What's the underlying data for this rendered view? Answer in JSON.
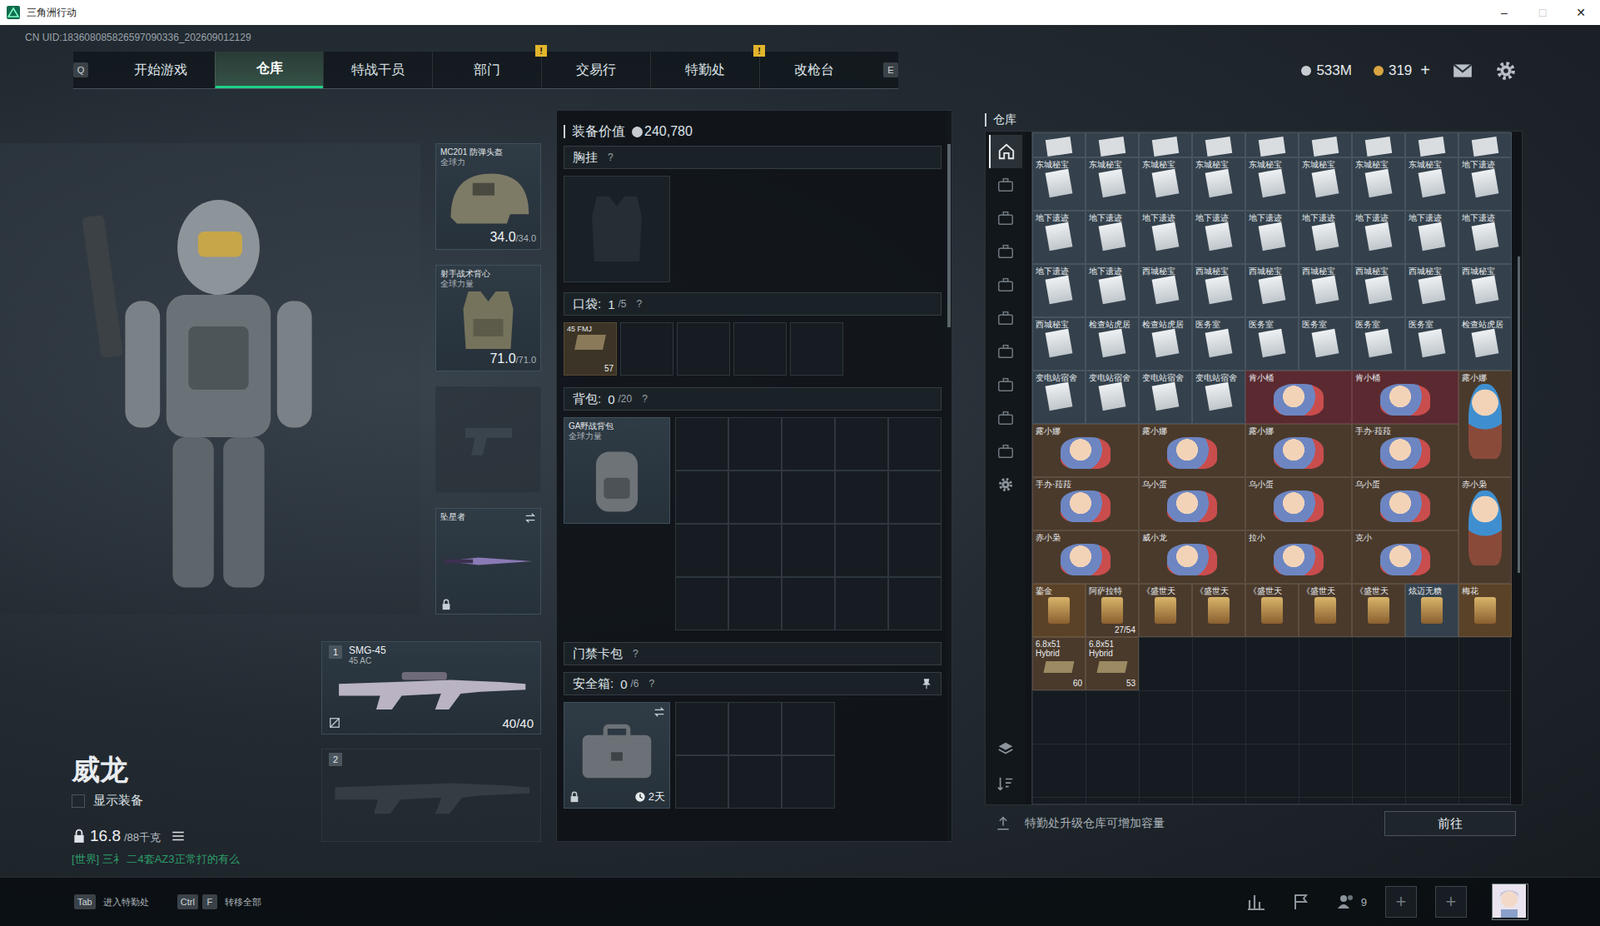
{
  "window": {
    "title": "三角洲行动",
    "controls": [
      {
        "glyph": "–",
        "disabled": false
      },
      {
        "glyph": "□",
        "disabled": true
      },
      {
        "glyph": "✕",
        "disabled": false
      }
    ]
  },
  "uid": "CN UID:183608085826597090336_202609012129",
  "nav": {
    "prev_key": "Q",
    "next_key": "E",
    "tabs": [
      {
        "label": "开始游戏",
        "selected": false,
        "badge": ""
      },
      {
        "label": "仓库",
        "selected": true,
        "badge": ""
      },
      {
        "label": "特战干员",
        "selected": false,
        "badge": ""
      },
      {
        "label": "部门",
        "selected": false,
        "badge": "!"
      },
      {
        "label": "交易行",
        "selected": false,
        "badge": ""
      },
      {
        "label": "特勤处",
        "selected": false,
        "badge": "!"
      },
      {
        "label": "改枪台",
        "selected": false,
        "badge": ""
      }
    ]
  },
  "currency": [
    {
      "amount": "533M",
      "color": "#c8ccd0",
      "plus": ""
    },
    {
      "amount": "319",
      "color": "#d9a441",
      "plus": "+"
    }
  ],
  "character": {
    "name": "威龙",
    "show_gear": {
      "label": "显示装备",
      "checked": false
    },
    "weight": "16.8",
    "weight_max": "/88千克",
    "chat": "[世界] 三礻 二4套AZ3正常打的有么"
  },
  "gear": {
    "helmet": {
      "title": "MC201 防弹头盔",
      "sub": "全球力",
      "value": "34.0",
      "max": "/34.0"
    },
    "armor": {
      "title": "射手战术背心",
      "sub": "全球力量",
      "value": "71.0",
      "max": "/71.0"
    },
    "pistol": {
      "filled": false
    },
    "melee": {
      "title": "坠星者",
      "locked": true
    },
    "weapons": [
      {
        "slot": "1",
        "name": "SMG-45",
        "sub": "45 AC",
        "ammo": "40/40",
        "filled": true
      },
      {
        "slot": "2",
        "name": "",
        "sub": "",
        "ammo": "",
        "filled": false
      }
    ]
  },
  "loadout": {
    "value_label": "装备价值",
    "value": "240,780",
    "chest": {
      "title": "胸挂",
      "help": "?"
    },
    "pockets": {
      "title": "口袋:",
      "count": "1",
      "cap": "/5",
      "help": "?",
      "slots": [
        {
          "name": "45 FMJ",
          "count": "57",
          "filled": true
        },
        {
          "name": "",
          "count": "",
          "filled": false
        },
        {
          "name": "",
          "count": "",
          "filled": false
        },
        {
          "name": "",
          "count": "",
          "filled": false
        },
        {
          "name": "",
          "count": "",
          "filled": false
        }
      ]
    },
    "backpack": {
      "title": "背包:",
      "count": "0",
      "cap": "/20",
      "help": "?",
      "name": "GA野战背包",
      "sub": "全球力量",
      "cells": 20
    },
    "keycard": {
      "title": "门禁卡包",
      "help": "?"
    },
    "safe": {
      "title": "安全箱:",
      "count": "0",
      "cap": "/6",
      "help": "?",
      "pinned": true,
      "locked": true,
      "timer": "2天",
      "cells": 6
    }
  },
  "warehouse": {
    "title": "仓库",
    "side_tabs": [
      {
        "kind": "home",
        "selected": true
      },
      {
        "kind": "case",
        "selected": false
      },
      {
        "kind": "case",
        "selected": false
      },
      {
        "kind": "case",
        "selected": false
      },
      {
        "kind": "case",
        "selected": false
      },
      {
        "kind": "case",
        "selected": false
      },
      {
        "kind": "case",
        "selected": false
      },
      {
        "kind": "case",
        "selected": false
      },
      {
        "kind": "case",
        "selected": false
      },
      {
        "kind": "case",
        "selected": false
      },
      {
        "kind": "gear",
        "selected": false
      }
    ],
    "items": [
      {
        "name": "",
        "kind": "doc-cut",
        "color": "#34414c",
        "count": ""
      },
      {
        "name": "",
        "kind": "doc-cut",
        "color": "#34414c",
        "count": ""
      },
      {
        "name": "",
        "kind": "doc-cut",
        "color": "#34414c",
        "count": ""
      },
      {
        "name": "",
        "kind": "doc-cut",
        "color": "#34414c",
        "count": ""
      },
      {
        "name": "",
        "kind": "doc-cut",
        "color": "#34414c",
        "count": ""
      },
      {
        "name": "",
        "kind": "doc-cut",
        "color": "#34414c",
        "count": ""
      },
      {
        "name": "",
        "kind": "doc-cut",
        "color": "#34414c",
        "count": ""
      },
      {
        "name": "",
        "kind": "doc-cut",
        "color": "#34414c",
        "count": ""
      },
      {
        "name": "",
        "kind": "doc-cut",
        "color": "#34414c",
        "count": ""
      },
      {
        "name": "东城秘宝",
        "kind": "doc",
        "color": "#34414c",
        "count": ""
      },
      {
        "name": "东城秘宝",
        "kind": "doc",
        "color": "#34414c",
        "count": ""
      },
      {
        "name": "东城秘宝",
        "kind": "doc",
        "color": "#34414c",
        "count": ""
      },
      {
        "name": "东城秘宝",
        "kind": "doc",
        "color": "#34414c",
        "count": ""
      },
      {
        "name": "东城秘宝",
        "kind": "doc",
        "color": "#34414c",
        "count": ""
      },
      {
        "name": "东城秘宝",
        "kind": "doc",
        "color": "#34414c",
        "count": ""
      },
      {
        "name": "东城秘宝",
        "kind": "doc",
        "color": "#34414c",
        "count": ""
      },
      {
        "name": "东城秘宝",
        "kind": "doc",
        "color": "#34414c",
        "count": ""
      },
      {
        "name": "地下遗迹",
        "kind": "doc",
        "color": "#34414c",
        "count": ""
      },
      {
        "name": "地下遗迹",
        "kind": "doc",
        "color": "#34414c",
        "count": ""
      },
      {
        "name": "地下遗迹",
        "kind": "doc",
        "color": "#34414c",
        "count": ""
      },
      {
        "name": "地下遗迹",
        "kind": "doc",
        "color": "#34414c",
        "count": ""
      },
      {
        "name": "地下遗迹",
        "kind": "doc",
        "color": "#34414c",
        "count": ""
      },
      {
        "name": "地下遗迹",
        "kind": "doc",
        "color": "#34414c",
        "count": ""
      },
      {
        "name": "地下遗迹",
        "kind": "doc",
        "color": "#34414c",
        "count": ""
      },
      {
        "name": "地下遗迹",
        "kind": "doc",
        "color": "#34414c",
        "count": ""
      },
      {
        "name": "地下遗迹",
        "kind": "doc",
        "color": "#34414c",
        "count": ""
      },
      {
        "name": "地下遗迹",
        "kind": "doc",
        "color": "#34414c",
        "count": ""
      },
      {
        "name": "地下遗迹",
        "kind": "doc",
        "color": "#34414c",
        "count": ""
      },
      {
        "name": "地下遗迹",
        "kind": "doc",
        "color": "#34414c",
        "count": ""
      },
      {
        "name": "西城秘宝",
        "kind": "doc",
        "color": "#34414c",
        "count": ""
      },
      {
        "name": "西城秘宝",
        "kind": "doc",
        "color": "#34414c",
        "count": ""
      },
      {
        "name": "西城秘宝",
        "kind": "doc",
        "color": "#34414c",
        "count": ""
      },
      {
        "name": "西城秘宝",
        "kind": "doc",
        "color": "#34414c",
        "count": ""
      },
      {
        "name": "西城秘宝",
        "kind": "doc",
        "color": "#34414c",
        "count": ""
      },
      {
        "name": "西城秘宝",
        "kind": "doc",
        "color": "#34414c",
        "count": ""
      },
      {
        "name": "西城秘宝",
        "kind": "doc",
        "color": "#34414c",
        "count": ""
      },
      {
        "name": "西城秘宝",
        "kind": "doc",
        "color": "#34414c",
        "count": ""
      },
      {
        "name": "检查站虎居",
        "kind": "doc",
        "color": "#34414c",
        "count": ""
      },
      {
        "name": "检查站虎居",
        "kind": "doc",
        "color": "#34414c",
        "count": ""
      },
      {
        "name": "医务室",
        "kind": "doc",
        "color": "#34414c",
        "count": ""
      },
      {
        "name": "医务室",
        "kind": "doc",
        "color": "#34414c",
        "count": ""
      },
      {
        "name": "医务室",
        "kind": "doc",
        "color": "#34414c",
        "count": ""
      },
      {
        "name": "医务室",
        "kind": "doc",
        "color": "#34414c",
        "count": ""
      },
      {
        "name": "医务室",
        "kind": "doc",
        "color": "#34414c",
        "count": ""
      },
      {
        "name": "检查站虎居",
        "kind": "doc",
        "color": "#34414c",
        "count": ""
      },
      {
        "name": "变电站宿舍",
        "kind": "doc",
        "color": "#34414c",
        "count": ""
      },
      {
        "name": "变电站宿舍",
        "kind": "doc",
        "color": "#34414c",
        "count": ""
      },
      {
        "name": "变电站宿舍",
        "kind": "doc",
        "color": "#34414c",
        "count": ""
      },
      {
        "name": "变电站宿舍",
        "kind": "doc",
        "color": "#34414c",
        "count": ""
      },
      {
        "name": "肯小桶",
        "kind": "toy-wide",
        "color": "#5a2a30",
        "count": ""
      },
      {
        "name": "肯小桶",
        "kind": "toy-wide",
        "color": "#5a2a30",
        "count": ""
      },
      {
        "name": "露小娜",
        "kind": "toy-tall",
        "color": "#4a3a2c",
        "count": ""
      },
      {
        "name": "露小娜",
        "kind": "toy-wide",
        "color": "#4a3a2c",
        "count": ""
      },
      {
        "name": "露小娜",
        "kind": "toy-wide",
        "color": "#4a3a2c",
        "count": ""
      },
      {
        "name": "露小娜",
        "kind": "toy-wide",
        "color": "#4a3a2c",
        "count": ""
      },
      {
        "name": "手办·菈菈",
        "kind": "toy-wide",
        "color": "#4a3a2c",
        "count": ""
      },
      {
        "name": "手办·菈菈",
        "kind": "toy-wide",
        "color": "#4a3a2c",
        "count": ""
      },
      {
        "name": "乌小蛋",
        "kind": "toy-wide",
        "color": "#4a3a2c",
        "count": ""
      },
      {
        "name": "乌小蛋",
        "kind": "toy-wide",
        "color": "#4a3a2c",
        "count": ""
      },
      {
        "name": "乌小蛋",
        "kind": "toy-wide",
        "color": "#4a3a2c",
        "count": ""
      },
      {
        "name": "赤小枭",
        "kind": "toy-tall",
        "color": "#4a3a2c",
        "count": ""
      },
      {
        "name": "赤小枭",
        "kind": "toy-wide",
        "color": "#4a3a2c",
        "count": ""
      },
      {
        "name": "威小龙",
        "kind": "toy-wide",
        "color": "#4a3a2c",
        "count": ""
      },
      {
        "name": "拉小",
        "kind": "toy-wide",
        "color": "#4a3a2c",
        "count": ""
      },
      {
        "name": "克小",
        "kind": "toy-wide",
        "color": "#4a3a2c",
        "count": ""
      },
      {
        "name": "鎏金",
        "kind": "relic",
        "color": "#5a4228",
        "count": ""
      },
      {
        "name": "阿萨拉特",
        "kind": "relic",
        "color": "#4a3a2c",
        "count": "27/54"
      },
      {
        "name": "《盛世天",
        "kind": "relic",
        "color": "#4a3a2c",
        "count": ""
      },
      {
        "name": "《盛世天",
        "kind": "relic",
        "color": "#4a3a2c",
        "count": ""
      },
      {
        "name": "《盛世天",
        "kind": "relic",
        "color": "#4a3a2c",
        "count": ""
      },
      {
        "name": "《盛世天",
        "kind": "relic",
        "color": "#4a3a2c",
        "count": ""
      },
      {
        "name": "《盛世天",
        "kind": "relic",
        "color": "#4a3a2c",
        "count": ""
      },
      {
        "name": "炫迈无糖",
        "kind": "relic",
        "color": "#34414c",
        "count": ""
      },
      {
        "name": "梅花",
        "kind": "relic",
        "color": "#5a4228",
        "count": ""
      },
      {
        "name": "6.8x51 Hybrid",
        "kind": "ammo",
        "color": "#4a3a2c",
        "count": "60"
      },
      {
        "name": "6.8x51 Hybrid",
        "kind": "ammo",
        "color": "#4a3a2c",
        "count": "53"
      }
    ],
    "footer": "特勤处升级仓库可增加容量",
    "button": "前往"
  },
  "bottom_bar": {
    "hints": [
      {
        "keys": [
          "Tab"
        ],
        "label": "进入特勤处"
      },
      {
        "keys": [
          "Ctrl",
          "F"
        ],
        "label": "转移全部"
      }
    ],
    "friends": "9",
    "party_slots": [
      "+",
      "+"
    ]
  }
}
